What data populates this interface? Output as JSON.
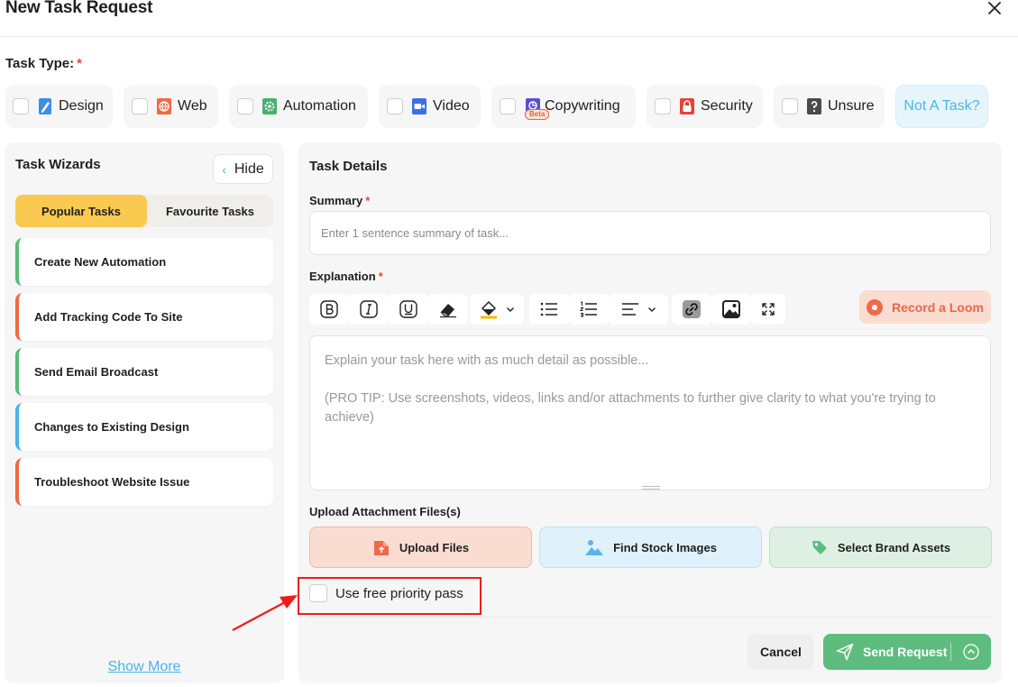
{
  "dialog": {
    "title": "New Task Request"
  },
  "task_type": {
    "label": "Task Type:",
    "required_mark": "*",
    "options": [
      {
        "label": "Design",
        "icon": "pencil-icon"
      },
      {
        "label": "Web",
        "icon": "globe-icon"
      },
      {
        "label": "Automation",
        "icon": "gear-icon"
      },
      {
        "label": "Video",
        "icon": "video-camera-icon"
      },
      {
        "label": "Copywriting",
        "icon": "copywriting-icon",
        "badge": "Beta"
      },
      {
        "label": "Security",
        "icon": "lock-icon"
      },
      {
        "label": "Unsure",
        "icon": "question-icon"
      }
    ],
    "not_a_task": "Not A Task?"
  },
  "wizard": {
    "title": "Task Wizards",
    "hide_label": "Hide",
    "tabs": [
      "Popular Tasks",
      "Favourite Tasks"
    ],
    "items": [
      {
        "label": "Create New Automation",
        "accent": "#5bb97a"
      },
      {
        "label": "Add Tracking Code To Site",
        "accent": "#ee6a44"
      },
      {
        "label": "Send Email Broadcast",
        "accent": "#5bb97a"
      },
      {
        "label": "Changes to Existing Design",
        "accent": "#49b5e5"
      },
      {
        "label": "Troubleshoot Website Issue",
        "accent": "#ee6a44"
      }
    ],
    "show_more": "Show More"
  },
  "details": {
    "title": "Task Details",
    "summary_label": "Summary",
    "summary_placeholder": "Enter 1 sentence summary of task...",
    "explanation_label": "Explanation",
    "record_loom": "Record a Loom",
    "explanation_placeholder_line1": "Explain your task here with as much detail as possible...",
    "explanation_placeholder_line2": "(PRO TIP: Use screenshots, videos, links and/or attachments to further give clarity to what you're trying to achieve)",
    "upload_label": "Upload Attachment Files(s)",
    "upload_buttons": [
      "Upload Files",
      "Find Stock Images",
      "Select Brand Assets"
    ],
    "priority_pass": "Use free priority pass",
    "cancel": "Cancel",
    "send": "Send Request"
  },
  "colors": {
    "accent_blue": "#49b5e5",
    "accent_yellow": "#f9ca4f",
    "accent_green": "#5ebd7e",
    "accent_orange": "#ee6a44",
    "annotation_red": "#ee1c1c"
  }
}
